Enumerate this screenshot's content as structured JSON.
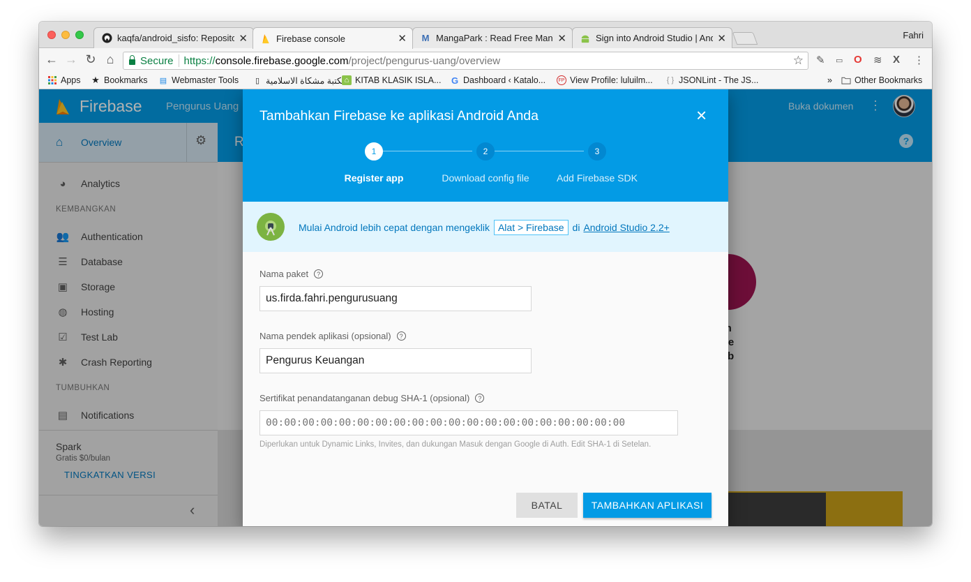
{
  "browser": {
    "profile_name": "Fahri",
    "tabs": [
      {
        "title": "kaqfa/android_sisfo: Repository",
        "icon": "github-icon",
        "active": false
      },
      {
        "title": "Firebase console",
        "icon": "firebase-icon",
        "active": true
      },
      {
        "title": "MangaPark : Read Free Manga",
        "icon": "mangapark-icon",
        "active": false
      },
      {
        "title": "Sign into Android Studio | Andr",
        "icon": "android-icon",
        "active": false
      }
    ],
    "address": {
      "secure_label": "Secure",
      "scheme": "https://",
      "host": "console.firebase.google.com",
      "path": "/project/pengurus-uang/overview"
    },
    "bookmarks": [
      {
        "label": "Apps",
        "icon": "apps-grid-icon"
      },
      {
        "label": "Bookmarks",
        "icon": "star-icon"
      },
      {
        "label": "Webmaster Tools",
        "icon": "webmaster-icon"
      },
      {
        "label": "مكتبة مشكاة الاسلامية",
        "icon": "page-icon"
      },
      {
        "label": "KITAB KLASIK ISLA...",
        "icon": "home-icon"
      },
      {
        "label": "Dashboard ‹ Katalo...",
        "icon": "google-icon"
      },
      {
        "label": "View Profile: luluilm...",
        "icon": "fp-icon"
      },
      {
        "label": "JSONLint - The JS...",
        "icon": "braces-icon"
      }
    ],
    "bookmarks_more": "»",
    "other_bookmarks": "Other Bookmarks"
  },
  "firebase": {
    "brand": "Firebase",
    "project": "Pengurus Uang",
    "docs_link": "Buka dokumen",
    "sidebar": {
      "overview": "Overview",
      "analytics": "Analytics",
      "section_develop": "KEMBANGKAN",
      "develop_items": [
        "Authentication",
        "Database",
        "Storage",
        "Hosting",
        "Test Lab",
        "Crash Reporting"
      ],
      "section_grow": "TUMBUHKAN",
      "grow_items": [
        "Notifications"
      ],
      "plan_name": "Spark",
      "plan_price": "Gratis $0/bulan",
      "upgrade": "TINGKATKAN VERSI",
      "collapse": "‹"
    },
    "banner_letter": "R",
    "peek_text": [
      "kan",
      "e ke",
      "web",
      "n"
    ]
  },
  "modal": {
    "title": "Tambahkan Firebase ke aplikasi Android Anda",
    "close": "×",
    "steps": [
      {
        "num": "1",
        "label": "Register app"
      },
      {
        "num": "2",
        "label": "Download config file"
      },
      {
        "num": "3",
        "label": "Add Firebase SDK"
      }
    ],
    "hint": {
      "prefix": "Mulai Android lebih cepat dengan mengeklik",
      "chip": "Alat > Firebase",
      "middle": "di",
      "link": "Android Studio 2.2+"
    },
    "fields": {
      "package_label": "Nama paket",
      "package_value": "us.firda.fahri.pengurusuang",
      "nickname_label": "Nama pendek aplikasi (opsional)",
      "nickname_value": "Pengurus Keuangan",
      "sha_label": "Sertifikat penandatanganan debug SHA-1 (opsional)",
      "sha_placeholder": "00:00:00:00:00:00:00:00:00:00:00:00:00:00:00:00:00:00:00:00",
      "sha_help": "Diperlukan untuk Dynamic Links, Invites, dan dukungan Masuk dengan Google di Auth. Edit SHA-1 di Setelan."
    },
    "buttons": {
      "cancel": "BATAL",
      "add": "TAMBAHKAN APLIKASI"
    }
  }
}
